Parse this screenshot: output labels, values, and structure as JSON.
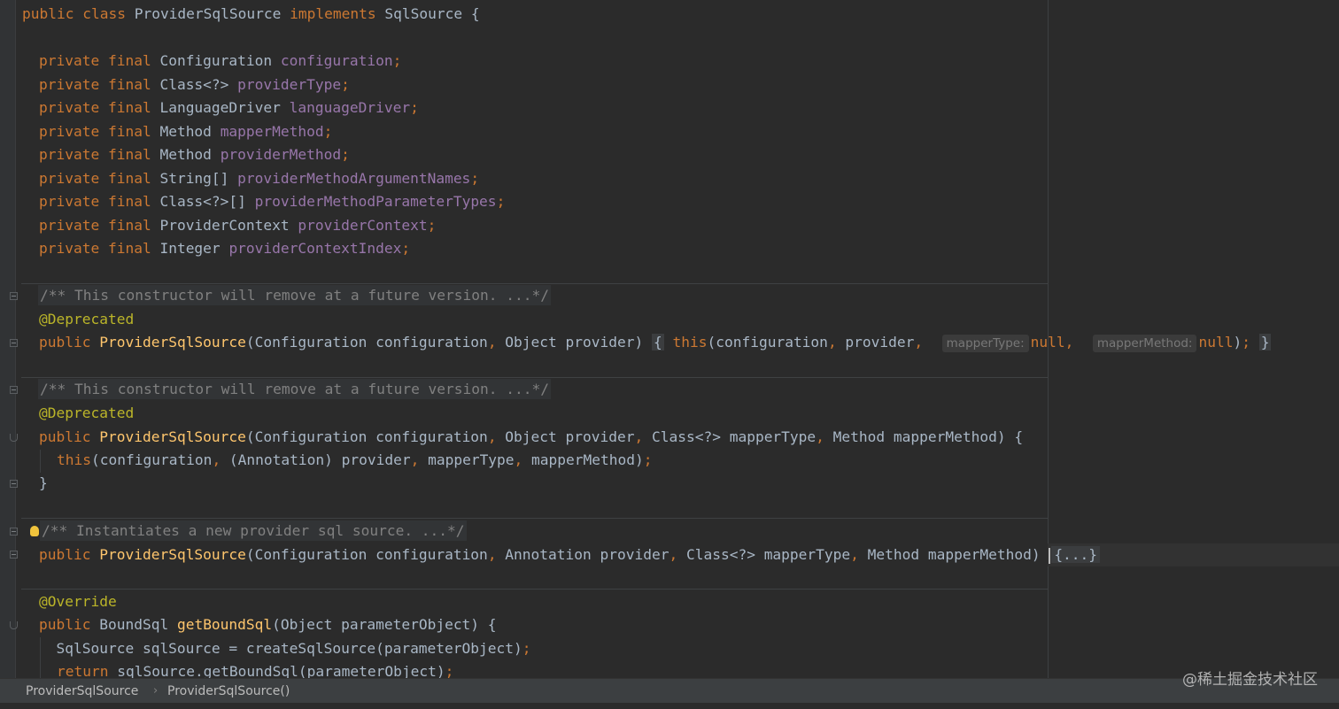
{
  "code": {
    "line1": {
      "kw1": "public class",
      "name": "ProviderSqlSource",
      "kw2": "implements",
      "rest": "SqlSource {"
    },
    "fields": [
      {
        "mod": "private final",
        "type": "Configuration",
        "name": "configuration"
      },
      {
        "mod": "private final",
        "type": "Class<?>",
        "name": "providerType"
      },
      {
        "mod": "private final",
        "type": "LanguageDriver",
        "name": "languageDriver"
      },
      {
        "mod": "private final",
        "type": "Method",
        "name": "mapperMethod"
      },
      {
        "mod": "private final",
        "type": "Method",
        "name": "providerMethod"
      },
      {
        "mod": "private final",
        "type": "String[]",
        "name": "providerMethodArgumentNames"
      },
      {
        "mod": "private final",
        "type": "Class<?>[]",
        "name": "providerMethodParameterTypes"
      },
      {
        "mod": "private final",
        "type": "ProviderContext",
        "name": "providerContext"
      },
      {
        "mod": "private final",
        "type": "Integer",
        "name": "providerContextIndex"
      }
    ],
    "semicolon": ";",
    "comma": ",",
    "kw_public": "public",
    "kw_this": "this",
    "kw_null": "null",
    "kw_return": "return",
    "ctor_name": "ProviderSqlSource",
    "ctor1": {
      "comment": "/** This constructor will remove at a future version. ...*/",
      "annotation": "@Deprecated",
      "params": "(Configuration configuration",
      "params2": " Object provider) ",
      "open": "{",
      "call_args": "(configuration",
      "call_args2": " provider",
      "hint1": "mapperType:",
      "hint2": "mapperMethod:",
      "close_paren": ")",
      "close": "}"
    },
    "ctor2": {
      "comment": "/** This constructor will remove at a future version. ...*/",
      "annotation": "@Deprecated",
      "p1": "(Configuration configuration",
      "p2": " Object provider",
      "p3": " Class<?> mapperType",
      "p4": " Method mapperMethod) {",
      "b1": "(configuration",
      "b2": " (Annotation) provider",
      "b3": " mapperType",
      "b4": " mapperMethod)",
      "close": "}"
    },
    "ctor3": {
      "comment": "/** Instantiates a new provider sql source. ...*/",
      "p1": "(Configuration configuration",
      "p2": " Annotation provider",
      "p3": " Class<?> mapperType",
      "p4": " Method mapperMethod) ",
      "folded": "{...}"
    },
    "method": {
      "annotation": "@Override",
      "ret_type": " BoundSql ",
      "name": "getBoundSql",
      "params": "(Object parameterObject) {",
      "body1": "  SqlSource sqlSource = createSqlSource(parameterObject)",
      "body2_rest": " sqlSource.getBoundSql(parameterObject)"
    }
  },
  "breadcrumb": {
    "items": [
      "ProviderSqlSource",
      "ProviderSqlSource()"
    ],
    "separator": "›"
  },
  "watermark": "@稀土掘金技术社区",
  "colors": {
    "background": "#2b2b2b",
    "keyword": "#cc7832",
    "field": "#9876aa",
    "method": "#ffc66d",
    "annotation": "#bbb529",
    "comment": "#808080",
    "text": "#a9b7c6"
  }
}
